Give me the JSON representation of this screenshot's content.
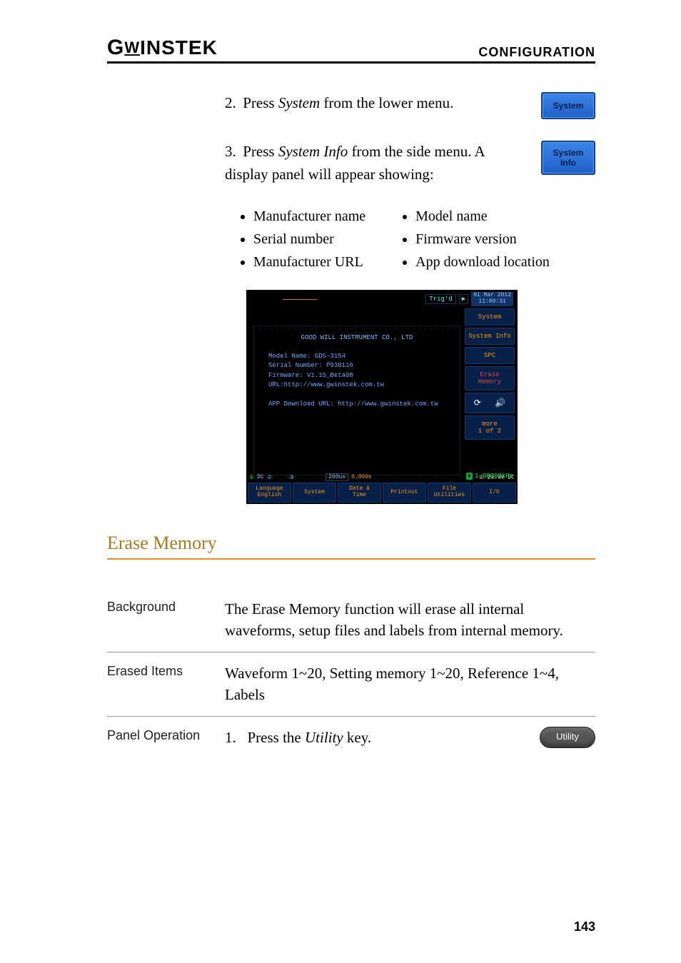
{
  "header": {
    "logo_text": "GWINSTEK",
    "section": "CONFIGURATION"
  },
  "steps": [
    {
      "num": "2.",
      "pre": "Press ",
      "em": "System",
      "post": " from the lower menu.",
      "key": {
        "line1": "System",
        "line2": ""
      }
    },
    {
      "num": "3.",
      "pre": "Press ",
      "em": "System Info",
      "post": " from the side menu. A display panel will appear showing:",
      "key": {
        "line1": "System",
        "line2": "Info"
      }
    }
  ],
  "info_bullets_left": [
    "Manufacturer name",
    "Serial number",
    "Manufacturer URL"
  ],
  "info_bullets_right": [
    "Model name",
    "Firmware version",
    "App download location"
  ],
  "screenshot": {
    "trig": "Trig'd",
    "date": "01 Mar 2012",
    "time": "11:00:31",
    "side": [
      "System",
      "System Info",
      "SPC",
      "Erase Memory"
    ],
    "side_more": "more\n1 of 2",
    "mfr": "GOOD WILL INSTRUMENT CO., LTD",
    "lines": [
      "Model Name: GDS-3154",
      "Serial Number: P930116",
      "Firmware: V1.15_Beta08",
      "URL:http://www.gwinstek.com.tw",
      "",
      "APP Download URL: http://www.gwinstek.com.tw"
    ],
    "status_freq": "1.00000kHz",
    "status_tb": "200us",
    "status_pos": "0.000s",
    "status_trig": "24.4V",
    "status_dc": "DC",
    "bottom": [
      {
        "l1": "Language",
        "l2": "English"
      },
      {
        "l1": "System",
        "l2": ""
      },
      {
        "l1": "Date &",
        "l2": "Time"
      },
      {
        "l1": "Printout",
        "l2": ""
      },
      {
        "l1": "File",
        "l2": "Utilities"
      },
      {
        "l1": "I/O",
        "l2": ""
      }
    ]
  },
  "section2": {
    "title": "Erase Memory",
    "rows": [
      {
        "label": "Background",
        "text": "The Erase Memory function will erase all internal waveforms, setup files and labels from internal memory."
      },
      {
        "label": "Erased Items",
        "text": "Waveform 1~20, Setting memory 1~20, Reference 1~4, Labels"
      }
    ],
    "op_label": "Panel Operation",
    "op_num": "1.",
    "op_pre": "Press the ",
    "op_em": "Utility",
    "op_post": " key.",
    "op_key": "Utility"
  },
  "page_number": "143"
}
